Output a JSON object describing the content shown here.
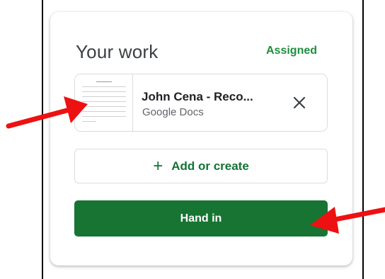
{
  "card": {
    "title": "Your work",
    "status": "Assigned",
    "status_color": "#1e8e3e"
  },
  "attachment": {
    "title": "John Cena - Reco...",
    "type": "Google Docs",
    "thumbnail_icon": "document-thumbnail",
    "remove_icon": "close-icon"
  },
  "actions": {
    "add_icon": "plus-icon",
    "add_label": "Add or create",
    "hand_in_label": "Hand in",
    "hand_in_color": "#187432"
  },
  "annotations": {
    "arrow_color": "#ee1111"
  }
}
